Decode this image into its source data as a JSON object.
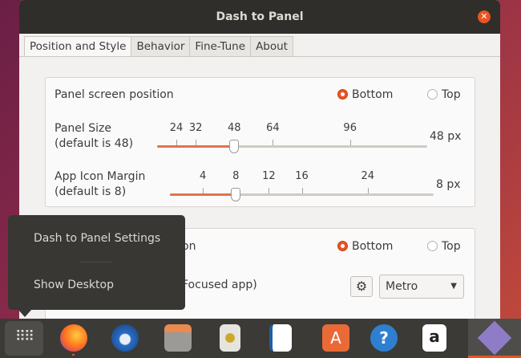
{
  "window": {
    "title": "Dash to Panel",
    "close_icon": "close-icon"
  },
  "tabs": [
    {
      "label": "Position and Style",
      "active": true
    },
    {
      "label": "Behavior"
    },
    {
      "label": "Fine-Tune"
    },
    {
      "label": "About"
    }
  ],
  "position": {
    "label": "Panel screen position",
    "options": [
      "Bottom",
      "Top"
    ],
    "selected": "Bottom"
  },
  "panel_size": {
    "label": "Panel Size",
    "default": "(default is 48)",
    "ticks": [
      24,
      32,
      48,
      64,
      96
    ],
    "min": 16,
    "max": 128,
    "value": 48,
    "value_label": "48 px"
  },
  "icon_margin": {
    "label": "App Icon Margin",
    "default": "(default is 8)",
    "ticks": [
      4,
      8,
      12,
      16,
      24
    ],
    "min": 0,
    "max": 32,
    "value": 8,
    "value_label": "8 px"
  },
  "section2": {
    "label_partial": "on",
    "options": [
      "Bottom",
      "Top"
    ],
    "selected": "Bottom",
    "indicator_partial": "Focused app)",
    "style_select": "Metro"
  },
  "menu": {
    "items": [
      "Dash to Panel Settings",
      "Show Desktop"
    ]
  },
  "dock": {
    "apps": [
      "show-apps",
      "firefox",
      "thunderbird",
      "files",
      "rhythmbox",
      "libreoffice-writer",
      "software-center",
      "help",
      "amazon",
      "extension"
    ]
  },
  "colors": {
    "accent": "#e95420"
  }
}
